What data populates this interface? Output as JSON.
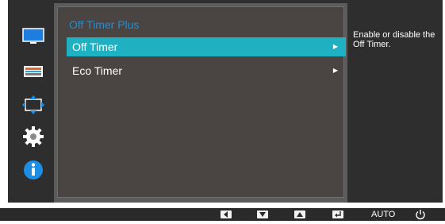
{
  "menu": {
    "title": "Off Timer Plus",
    "items": [
      {
        "label": "Off Timer",
        "selected": true
      },
      {
        "label": "Eco Timer",
        "selected": false
      }
    ],
    "description": "Enable or disable the Off Timer."
  },
  "sidebar": {
    "icons": [
      "picture-icon",
      "color-icon",
      "size-position-icon",
      "setup-icon",
      "information-icon"
    ]
  },
  "bottom_bar": {
    "buttons": [
      "left-icon",
      "down-icon",
      "up-icon",
      "enter-icon"
    ],
    "auto_label": "AUTO",
    "power": "power-icon"
  },
  "colors": {
    "selection": "#1fb1c1",
    "title": "#1e8fd6",
    "info_blue": "#1d8ee6"
  }
}
